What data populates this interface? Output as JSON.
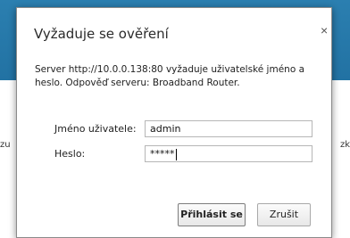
{
  "background": {
    "left_text": "zu",
    "right_text": "zk"
  },
  "dialog": {
    "title": "Vyžaduje se ověření",
    "close_glyph": "×",
    "message": "Server http://10.0.0.138:80 vyžaduje uživatelské jméno a heslo. Odpověď serveru: Broadband Router.",
    "username_label": "Jméno uživatele:",
    "username_value": "admin",
    "password_label": "Heslo:",
    "password_masked": "*****",
    "login_button": "Přihlásit se",
    "cancel_button": "Zrušit"
  },
  "colors": {
    "band": "#2b7fb0",
    "dialog_bg": "#ffffff"
  }
}
